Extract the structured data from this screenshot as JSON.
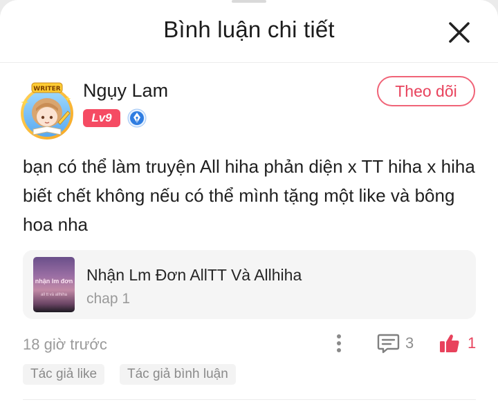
{
  "header": {
    "title": "Bình luận chi tiết",
    "close_icon": "close-icon"
  },
  "comment": {
    "author": {
      "name": "Ngụy Lam",
      "avatar_badge": "WRITER",
      "level": "Lv9",
      "verified_icon": "pen-nib-badge-icon"
    },
    "follow_label": "Theo dõi",
    "text": "bạn có thể làm truyện All hiha phản diện x TT hiha x hiha biết chết không nếu có thể mình tặng một like và bông hoa nha",
    "story": {
      "title": "Nhận Lm Đơn AllTT Và Allhiha",
      "chapter": "chap 1",
      "cover_text": "nhận lm đơn",
      "cover_subtext": "all tt và allhiha"
    },
    "time": "18 giờ trước",
    "reply_count": "3",
    "like_count": "1",
    "tags": [
      "Tác giả like",
      "Tác giả bình luận"
    ]
  },
  "colors": {
    "accent": "#e8425c",
    "level_badge": "#f54b63",
    "verified": "#2f7de1",
    "muted": "#9a9a9a"
  }
}
